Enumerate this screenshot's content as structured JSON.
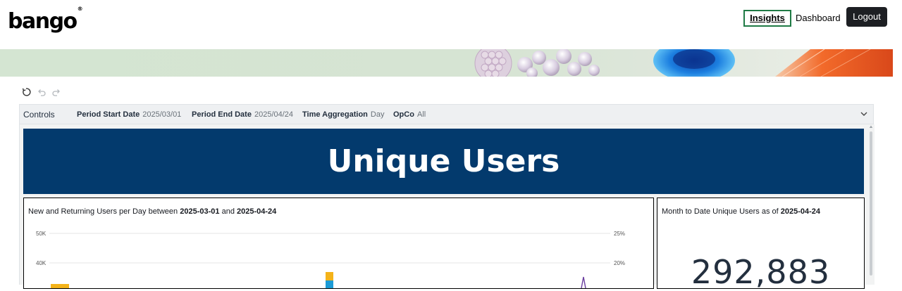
{
  "header": {
    "logo_text": "bango",
    "logo_mark": "®",
    "nav": [
      {
        "label": "Insights",
        "active": true
      },
      {
        "label": "Dashboard",
        "active": false
      }
    ],
    "logout_label": "Logout"
  },
  "toolbar": {
    "icons": [
      "reset-icon",
      "undo-icon",
      "redo-icon"
    ]
  },
  "controls": {
    "title": "Controls",
    "filters": [
      {
        "label": "Period Start Date",
        "value": "2025/03/01"
      },
      {
        "label": "Period End Date",
        "value": "2025/04/24"
      },
      {
        "label": "Time Aggregation",
        "value": "Day"
      },
      {
        "label": "OpCo",
        "value": "All"
      }
    ],
    "expand_icon": "chevron-down-icon"
  },
  "dashboard": {
    "heading": "Unique Users",
    "chart_panel": {
      "title_prefix": "New and Returning Users per Day between",
      "start": "2025-03-01",
      "and": "and",
      "end": "2025-04-24"
    },
    "kpi_panel": {
      "title_prefix": "Month to Date Unique Users as of",
      "date": "2025-04-24",
      "value": "292,883"
    }
  },
  "chart_data": {
    "type": "bar",
    "title": "New and Returning Users per Day between 2025-03-01 and 2025-04-24",
    "y_ticks_left": [
      "50K",
      "40K"
    ],
    "y_ticks_right": [
      "25%",
      "20%"
    ],
    "ylim_left_visible": [
      40000,
      50000
    ],
    "ylim_right_visible": [
      20,
      25
    ],
    "grid": true,
    "colors": {
      "series_a": "#f4b31a",
      "series_b": "#1c9bd6",
      "line": "#6b3fa0"
    }
  }
}
